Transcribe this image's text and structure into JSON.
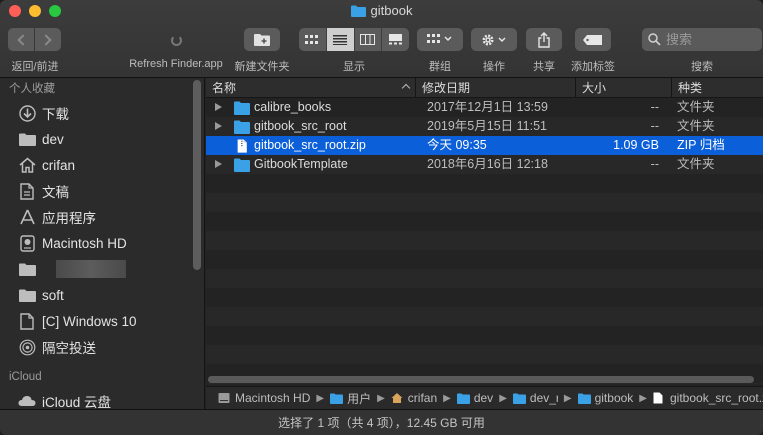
{
  "window": {
    "title": "gitbook"
  },
  "toolbar": {
    "nav_label": "返回/前进",
    "refresh_label": "Refresh Finder.app",
    "new_folder_label": "新建文件夹",
    "view_label": "显示",
    "group_label": "群组",
    "action_label": "操作",
    "share_label": "共享",
    "tag_label": "添加标签",
    "search_label": "搜索",
    "search_placeholder": "搜索"
  },
  "sidebar": {
    "favorites_header": "个人收藏",
    "items": [
      {
        "label": "下载",
        "icon": "download-icon"
      },
      {
        "label": "dev",
        "icon": "folder-icon"
      },
      {
        "label": "crifan",
        "icon": "home-icon"
      },
      {
        "label": "文稿",
        "icon": "document-icon"
      },
      {
        "label": "应用程序",
        "icon": "applications-icon"
      },
      {
        "label": "Macintosh HD",
        "icon": "harddisk-icon"
      },
      {
        "label": "",
        "icon": "folder-icon"
      },
      {
        "label": "soft",
        "icon": "folder-icon"
      },
      {
        "label": "[C] Windows 10",
        "icon": "document-icon"
      },
      {
        "label": "隔空投送",
        "icon": "airdrop-icon"
      }
    ],
    "icloud_header": "iCloud",
    "icloud_items": [
      {
        "label": "iCloud 云盘",
        "icon": "cloud-icon"
      }
    ]
  },
  "columns": {
    "name": "名称",
    "date": "修改日期",
    "size": "大小",
    "kind": "种类"
  },
  "files": [
    {
      "name": "calibre_books",
      "date": "2017年12月1日 13:59",
      "size": "--",
      "kind": "文件夹",
      "type": "folder",
      "selected": false
    },
    {
      "name": "gitbook_src_root",
      "date": "2019年5月15日 11:51",
      "size": "--",
      "kind": "文件夹",
      "type": "folder",
      "selected": false
    },
    {
      "name": "gitbook_src_root.zip",
      "date": "今天 09:35",
      "size": "1.09 GB",
      "kind": "ZIP 归档",
      "type": "file",
      "selected": true
    },
    {
      "name": "GitbookTemplate",
      "date": "2018年6月16日 12:18",
      "size": "--",
      "kind": "文件夹",
      "type": "folder",
      "selected": false
    }
  ],
  "pathbar": [
    {
      "label": "Macintosh HD",
      "icon": "harddisk-icon"
    },
    {
      "label": "用户",
      "icon": "folder-icon"
    },
    {
      "label": "crifan",
      "icon": "home-icon"
    },
    {
      "label": "dev",
      "icon": "folder-icon"
    },
    {
      "label": "dev_rc",
      "icon": "folder-icon"
    },
    {
      "label": "gitbook",
      "icon": "folder-icon"
    },
    {
      "label": "gitbook_src_root.zip",
      "icon": "document-icon"
    }
  ],
  "status": {
    "text": "选择了 1 项（共 4 项），12.45 GB 可用"
  },
  "colors": {
    "selection": "#0b5fd9",
    "folder": "#3ba1e6"
  }
}
